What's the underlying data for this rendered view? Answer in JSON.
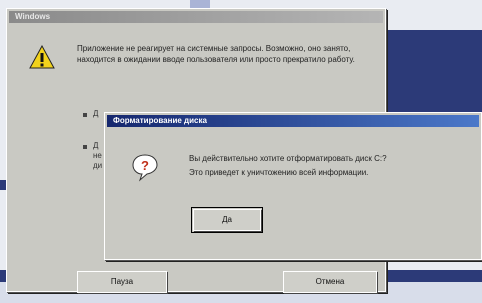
{
  "back_dialog": {
    "title": "Windows",
    "message": "Приложение не реагирует на системные запросы. Возможно, оно занято, находится в ожидании вводе пользователя или просто прекратило работу.",
    "options": [
      {
        "bullet": "Д",
        "text": "..."
      },
      {
        "bullet": "Д",
        "text": "не"
      },
      {
        "bullet": "",
        "text": "ди"
      }
    ],
    "buttons": {
      "left": "Пауза",
      "right": "Отмена"
    }
  },
  "front_dialog": {
    "title": "Форматирование диска",
    "message_line1": "Вы действительно хотите отформатировать диск С:?",
    "message_line2": "Это приведет к уничтожению всей информации.",
    "ok_label": "Да"
  },
  "icons": {
    "warning": "warning-icon",
    "question": "question-icon"
  },
  "colors": {
    "desktop_band": "#2c3a78",
    "active_title": "#15276e",
    "dialog_face": "#c9c9c3"
  }
}
